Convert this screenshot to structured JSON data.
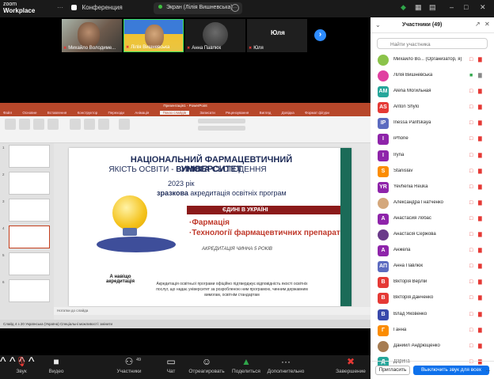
{
  "app": {
    "logo_top": "zoom",
    "logo_bottom": "Workplace"
  },
  "header": {
    "conference": "Конференция",
    "screen_label": "Экран (Лілія Вишневська)"
  },
  "participants_strip": {
    "tiles": [
      "Михайло Володиме...",
      "Лілія Вишневська",
      "Анна Павлюк",
      "Юля"
    ],
    "big_name": "Юля"
  },
  "presentation": {
    "title": "Презентація1 - PowerPoint",
    "menu": [
      "Файл",
      "Основне",
      "Вставлення",
      "Конструктор",
      "Переходи",
      "Анімація",
      "Показ слайдів",
      "Записати",
      "Рецензування",
      "Вигляд",
      "Довідка",
      "Формат фігури"
    ],
    "active_menu": "Показ слайдів",
    "slide_numbers": [
      "1",
      "2",
      "3",
      "4",
      "5",
      "6"
    ],
    "slide": {
      "heading": "НАЦІОНАЛЬНИЙ ФАРМАЦЕВТИЧНИЙ УНІВЕРСИТЕТ",
      "sub_1": "ЯКІСТЬ ОСВІТИ - ",
      "sub_2": "ВИМОГА",
      "sub_3": " СЬОГОДЕННЯ",
      "year": "2023 рік",
      "accr_bold": "зразкова",
      "accr_rest": " акредитація освітніх програм",
      "red_band": "ЄДИНІ В УКРАЇНІ",
      "bullet1": "·Фармація",
      "bullet2": "·Технології фармацевтичних препаратів",
      "validity": "АКРЕДИТАЦІЯ ЧИННА 5 РОКІВ",
      "question": "А навіщо акредитація",
      "footer": "Акредитація освітньої програми офіційно підтверджує відповідність якості освітніх послуг, що надає університет за розробленою ним програмою, чинним державним вимогам, освітнім стандартам"
    },
    "notes": "Нотатки до слайда",
    "status": "Слайд 4 з 20    Українська (Україна)    Спеціальні можливості: змінити"
  },
  "toolbar": {
    "mute": "Звук",
    "video": "Видео",
    "participants": "Участники",
    "participants_count": "49",
    "chat": "Чат",
    "record": "Отреагировать",
    "share": "Поделиться",
    "more": "Дополнительно",
    "end": "Завершение"
  },
  "panel": {
    "title": "Участники (49)",
    "search_placeholder": "Найти участника",
    "participants": [
      {
        "initials": "",
        "name": "Михайло Во... (Организатор, я)",
        "color": "#8bc34a",
        "photo": true
      },
      {
        "initials": "",
        "name": "Лілія Вишневська",
        "color": "#e040a0",
        "photo": true
      },
      {
        "initials": "AM",
        "name": "Alena Могильная",
        "color": "#26a69a"
      },
      {
        "initials": "AS",
        "name": "Anton Shylo",
        "color": "#e53935"
      },
      {
        "initials": "IP",
        "name": "Inessa Parifskaya",
        "color": "#5c6bc0"
      },
      {
        "initials": "I",
        "name": "iPhone",
        "color": "#8e24aa"
      },
      {
        "initials": "I",
        "name": "Iryna",
        "color": "#8e24aa"
      },
      {
        "initials": "S",
        "name": "Stanislav",
        "color": "#fb8c00"
      },
      {
        "initials": "YR",
        "name": "Yevhenia Reuka",
        "color": "#8e24aa"
      },
      {
        "initials": "",
        "name": "Александра Гнатченко",
        "color": "#d4a87c",
        "photo": true
      },
      {
        "initials": "А",
        "name": "Анастасия Лобас",
        "color": "#8e24aa"
      },
      {
        "initials": "",
        "name": "Анастасія Сержова",
        "color": "#6a3a8a",
        "photo": true
      },
      {
        "initials": "А",
        "name": "Анжела",
        "color": "#8e24aa"
      },
      {
        "initials": "АП",
        "name": "Анна Павлюк",
        "color": "#5c6bc0"
      },
      {
        "initials": "В",
        "name": "Вікторія Верлій",
        "color": "#e53935"
      },
      {
        "initials": "В",
        "name": "Вікторія Данченко",
        "color": "#e53935"
      },
      {
        "initials": "В",
        "name": "Влад Яковенко",
        "color": "#3949ab"
      },
      {
        "initials": "Г",
        "name": "Ганна",
        "color": "#fb8c00"
      },
      {
        "initials": "",
        "name": "Даниил Андрющенко",
        "color": "#a67c52",
        "photo": true
      },
      {
        "initials": "Д",
        "name": "Дарина",
        "color": "#26a69a"
      }
    ],
    "invite": "Пригласить",
    "mute_all": "Выключить звук для всех",
    "more": "..."
  }
}
